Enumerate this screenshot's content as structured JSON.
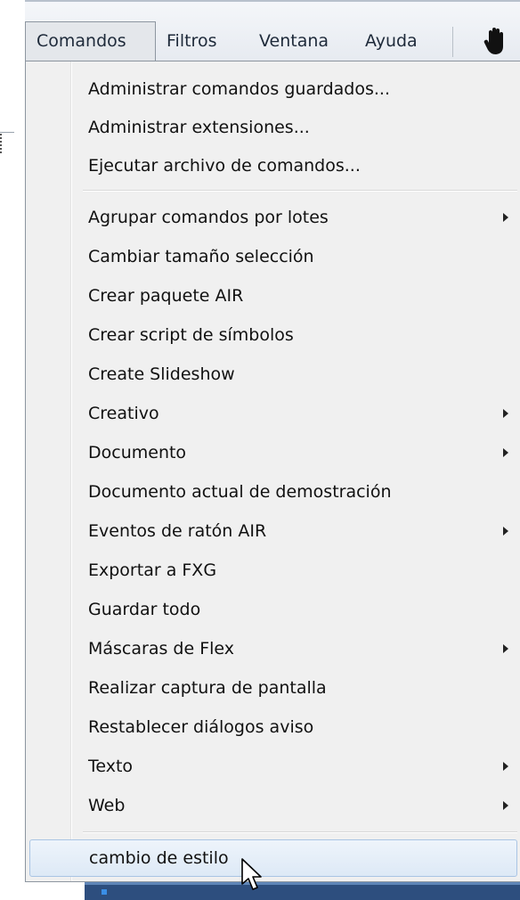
{
  "menubar": {
    "items": [
      "Comandos",
      "Filtros",
      "Ventana",
      "Ayuda"
    ],
    "active": "Comandos",
    "tool_icon": "hand-icon"
  },
  "dropdown": {
    "group1": [
      "Administrar comandos guardados...",
      "Administrar extensiones...",
      "Ejecutar archivo de comandos..."
    ],
    "group2": [
      {
        "label": "Agrupar comandos por lotes",
        "submenu": true
      },
      {
        "label": "Cambiar tamaño selección",
        "submenu": false
      },
      {
        "label": "Crear paquete AIR",
        "submenu": false
      },
      {
        "label": "Crear script de símbolos",
        "submenu": false
      },
      {
        "label": "Create Slideshow",
        "submenu": false
      },
      {
        "label": "Creativo",
        "submenu": true
      },
      {
        "label": "Documento",
        "submenu": true
      },
      {
        "label": "Documento actual de demostración",
        "submenu": false
      },
      {
        "label": "Eventos de ratón AIR",
        "submenu": true
      },
      {
        "label": "Exportar a FXG",
        "submenu": false
      },
      {
        "label": "Guardar todo",
        "submenu": false
      },
      {
        "label": "Máscaras de Flex",
        "submenu": true
      },
      {
        "label": "Realizar captura de pantalla",
        "submenu": false
      },
      {
        "label": "Restablecer diálogos aviso",
        "submenu": false
      },
      {
        "label": "Texto",
        "submenu": true
      },
      {
        "label": "Web",
        "submenu": true
      }
    ],
    "group3": [
      {
        "label": "cambio de estilo",
        "hovered": true
      }
    ]
  },
  "colors": {
    "hover_border": "#a9c4e4",
    "menu_bg": "#f0f0f0"
  }
}
